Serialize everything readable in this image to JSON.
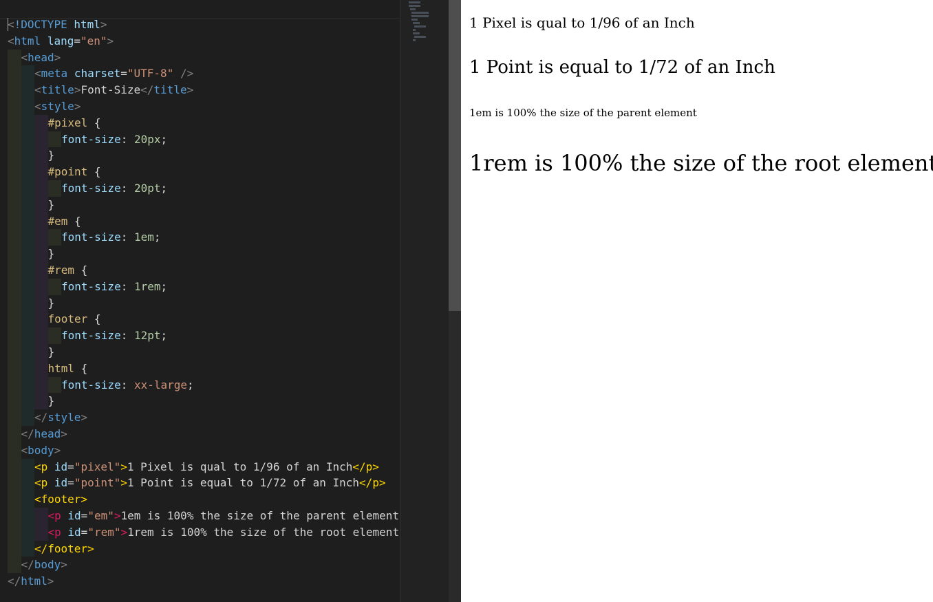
{
  "editor": {
    "lines": [
      [
        {
          "t": "<",
          "c": "t-br"
        },
        {
          "t": "!DOCTYPE",
          "c": "t-tag"
        },
        {
          "t": " ",
          "c": "t-txt"
        },
        {
          "t": "html",
          "c": "t-attr"
        },
        {
          "t": ">",
          "c": "t-br"
        }
      ],
      [
        {
          "t": "<",
          "c": "t-br"
        },
        {
          "t": "html",
          "c": "t-tag"
        },
        {
          "t": " ",
          "c": "t-txt"
        },
        {
          "t": "lang",
          "c": "t-attr"
        },
        {
          "t": "=",
          "c": "t-punc"
        },
        {
          "t": "\"en\"",
          "c": "t-str"
        },
        {
          "t": ">",
          "c": "t-br"
        }
      ],
      [
        {
          "t": "<",
          "c": "t-br"
        },
        {
          "t": "head",
          "c": "t-tag"
        },
        {
          "t": ">",
          "c": "t-br"
        }
      ],
      [
        {
          "t": "<",
          "c": "t-br"
        },
        {
          "t": "meta",
          "c": "t-tag"
        },
        {
          "t": " ",
          "c": "t-txt"
        },
        {
          "t": "charset",
          "c": "t-attr"
        },
        {
          "t": "=",
          "c": "t-punc"
        },
        {
          "t": "\"UTF-8\"",
          "c": "t-str"
        },
        {
          "t": " />",
          "c": "t-br"
        }
      ],
      [
        {
          "t": "<",
          "c": "t-br"
        },
        {
          "t": "title",
          "c": "t-tag"
        },
        {
          "t": ">",
          "c": "t-br"
        },
        {
          "t": "Font-Size",
          "c": "t-txt"
        },
        {
          "t": "</",
          "c": "t-br"
        },
        {
          "t": "title",
          "c": "t-tag"
        },
        {
          "t": ">",
          "c": "t-br"
        }
      ],
      [
        {
          "t": "<",
          "c": "t-br"
        },
        {
          "t": "style",
          "c": "t-tag"
        },
        {
          "t": ">",
          "c": "t-br"
        }
      ],
      [
        {
          "t": "#pixel",
          "c": "t-sel"
        },
        {
          "t": " {",
          "c": "t-punc"
        }
      ],
      [
        {
          "t": "font-size",
          "c": "t-prop"
        },
        {
          "t": ": ",
          "c": "t-punc"
        },
        {
          "t": "20px",
          "c": "t-num"
        },
        {
          "t": ";",
          "c": "t-punc"
        }
      ],
      [
        {
          "t": "}",
          "c": "t-punc"
        }
      ],
      [
        {
          "t": "#point",
          "c": "t-sel"
        },
        {
          "t": " {",
          "c": "t-punc"
        }
      ],
      [
        {
          "t": "font-size",
          "c": "t-prop"
        },
        {
          "t": ": ",
          "c": "t-punc"
        },
        {
          "t": "20pt",
          "c": "t-num"
        },
        {
          "t": ";",
          "c": "t-punc"
        }
      ],
      [
        {
          "t": "}",
          "c": "t-punc"
        }
      ],
      [
        {
          "t": "#em",
          "c": "t-sel"
        },
        {
          "t": " {",
          "c": "t-punc"
        }
      ],
      [
        {
          "t": "font-size",
          "c": "t-prop"
        },
        {
          "t": ": ",
          "c": "t-punc"
        },
        {
          "t": "1em",
          "c": "t-num"
        },
        {
          "t": ";",
          "c": "t-punc"
        }
      ],
      [
        {
          "t": "}",
          "c": "t-punc"
        }
      ],
      [
        {
          "t": "#rem",
          "c": "t-sel"
        },
        {
          "t": " {",
          "c": "t-punc"
        }
      ],
      [
        {
          "t": "font-size",
          "c": "t-prop"
        },
        {
          "t": ": ",
          "c": "t-punc"
        },
        {
          "t": "1rem",
          "c": "t-num"
        },
        {
          "t": ";",
          "c": "t-punc"
        }
      ],
      [
        {
          "t": "}",
          "c": "t-punc"
        }
      ],
      [
        {
          "t": "footer",
          "c": "t-sel"
        },
        {
          "t": " {",
          "c": "t-punc"
        }
      ],
      [
        {
          "t": "font-size",
          "c": "t-prop"
        },
        {
          "t": ": ",
          "c": "t-punc"
        },
        {
          "t": "12pt",
          "c": "t-num"
        },
        {
          "t": ";",
          "c": "t-punc"
        }
      ],
      [
        {
          "t": "}",
          "c": "t-punc"
        }
      ],
      [
        {
          "t": "html",
          "c": "t-sel"
        },
        {
          "t": " {",
          "c": "t-punc"
        }
      ],
      [
        {
          "t": "font-size",
          "c": "t-prop"
        },
        {
          "t": ": ",
          "c": "t-punc"
        },
        {
          "t": "xx-large",
          "c": "t-val"
        },
        {
          "t": ";",
          "c": "t-punc"
        }
      ],
      [
        {
          "t": "}",
          "c": "t-punc"
        }
      ],
      [
        {
          "t": "</",
          "c": "t-br"
        },
        {
          "t": "style",
          "c": "t-tag"
        },
        {
          "t": ">",
          "c": "t-br"
        }
      ],
      [
        {
          "t": "</",
          "c": "t-br"
        },
        {
          "t": "head",
          "c": "t-tag"
        },
        {
          "t": ">",
          "c": "t-br"
        }
      ],
      [
        {
          "t": "<",
          "c": "t-br"
        },
        {
          "t": "body",
          "c": "t-tag"
        },
        {
          "t": ">",
          "c": "t-br"
        }
      ],
      [
        {
          "t": "<p",
          "c": "t-gold"
        },
        {
          "t": " ",
          "c": "t-txt"
        },
        {
          "t": "id",
          "c": "t-attr"
        },
        {
          "t": "=",
          "c": "t-punc"
        },
        {
          "t": "\"pixel\"",
          "c": "t-str"
        },
        {
          "t": ">",
          "c": "t-gold"
        },
        {
          "t": "1 Pixel is qual to 1/96 of an Inch",
          "c": "t-txt"
        },
        {
          "t": "</p>",
          "c": "t-gold"
        }
      ],
      [
        {
          "t": "<p",
          "c": "t-gold"
        },
        {
          "t": " ",
          "c": "t-txt"
        },
        {
          "t": "id",
          "c": "t-attr"
        },
        {
          "t": "=",
          "c": "t-punc"
        },
        {
          "t": "\"point\"",
          "c": "t-str"
        },
        {
          "t": ">",
          "c": "t-gold"
        },
        {
          "t": "1 Point is equal to 1/72 of an Inch",
          "c": "t-txt"
        },
        {
          "t": "</p>",
          "c": "t-gold"
        }
      ],
      [
        {
          "t": "<footer>",
          "c": "t-gold"
        }
      ],
      [
        {
          "t": "<p",
          "c": "t-pink"
        },
        {
          "t": " ",
          "c": "t-txt"
        },
        {
          "t": "id",
          "c": "t-attr"
        },
        {
          "t": "=",
          "c": "t-punc"
        },
        {
          "t": "\"em\"",
          "c": "t-str"
        },
        {
          "t": ">",
          "c": "t-pink"
        },
        {
          "t": "1em is 100% the size of the parent element",
          "c": "t-txt"
        }
      ],
      [
        {
          "t": "<p",
          "c": "t-pink"
        },
        {
          "t": " ",
          "c": "t-txt"
        },
        {
          "t": "id",
          "c": "t-attr"
        },
        {
          "t": "=",
          "c": "t-punc"
        },
        {
          "t": "\"rem\"",
          "c": "t-str"
        },
        {
          "t": ">",
          "c": "t-pink"
        },
        {
          "t": "1rem is 100% the size of the root element",
          "c": "t-txt"
        }
      ],
      [
        {
          "t": "</footer>",
          "c": "t-gold"
        }
      ],
      [
        {
          "t": "</",
          "c": "t-br"
        },
        {
          "t": "body",
          "c": "t-tag"
        },
        {
          "t": ">",
          "c": "t-br"
        }
      ],
      [
        {
          "t": "</",
          "c": "t-br"
        },
        {
          "t": "html",
          "c": "t-tag"
        },
        {
          "t": ">",
          "c": "t-br"
        }
      ]
    ]
  },
  "preview": {
    "pixel_text": "1 Pixel is qual to 1/96 of an Inch",
    "point_text": "1 Point is equal to 1/72 of an Inch",
    "em_text": "1em is 100% the size of the parent element",
    "rem_text": "1rem is 100% the size of the root element"
  },
  "colors": {
    "editor_background": "#1e1e1e",
    "preview_background": "#ffffff",
    "tag_blue": "#569cd6",
    "string_orange": "#ce9178",
    "selector_yellow": "#d7ba7d",
    "bracket_gold": "#ffd700"
  }
}
